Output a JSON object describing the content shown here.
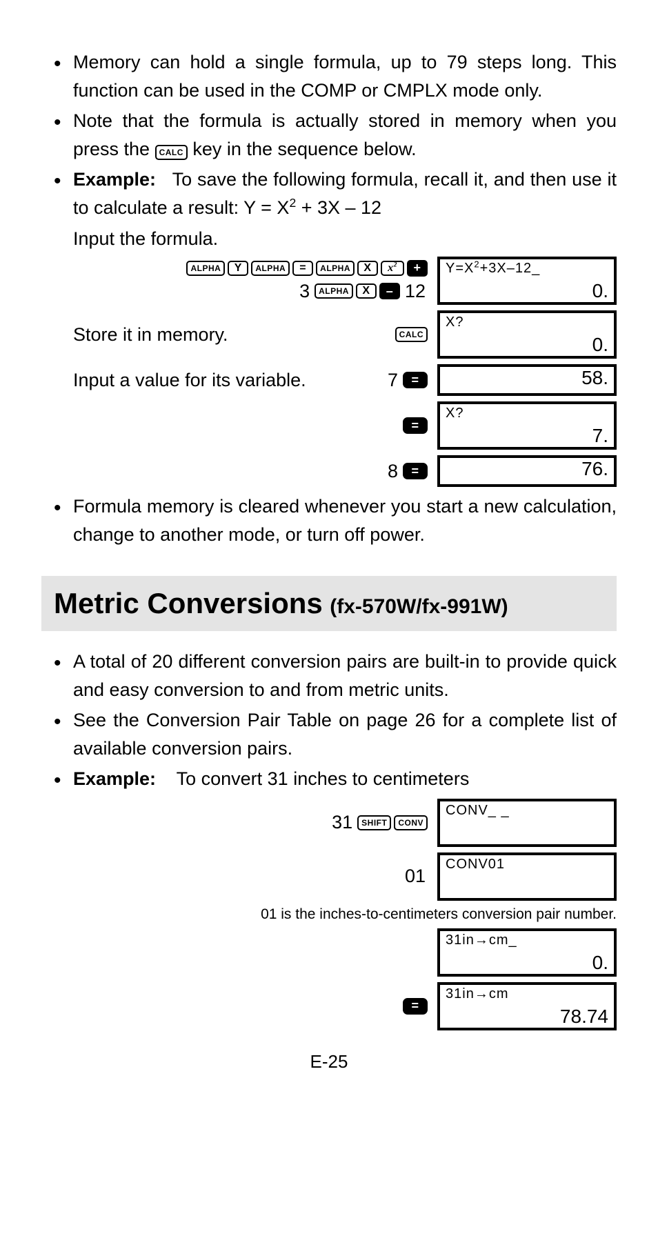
{
  "bullets_top": [
    "Memory can hold a single formula, up to 79 steps long. This function can be used in the COMP or CMPLX mode only.",
    "Note that the formula is actually stored in memory when you press the [CALC] key in the sequence below."
  ],
  "example1": {
    "label": "Example:",
    "text": "To save the following formula, recall it, and then use it to calculate a result: Y = X² + 3X – 12",
    "instr": "Input the formula."
  },
  "keys": {
    "alpha": "ALPHA",
    "Y": "Y",
    "eq": "=",
    "X": "X",
    "xsq": "x²",
    "plus": "+",
    "minus": "–",
    "calc": "CALC",
    "shift": "SHIFT",
    "conv": "CONV",
    "equals": "=",
    "three": "3",
    "twelve": "12",
    "seven": "7",
    "eight": "8",
    "thirtyone": "31",
    "zeroone": "01"
  },
  "displays": {
    "d1_top": "Y=X²+3X–12_",
    "d1_bot": "0.",
    "d2_top": "X?",
    "d2_bot": "0.",
    "d3_bot": "58.",
    "d4_top": "X?",
    "d4_bot": "7.",
    "d5_bot": "76.",
    "c1_top": "CONV_ _",
    "c2_top": "CONV01",
    "c3_top": "31in→cm_",
    "c3_bot": "0.",
    "c4_top": "31in→cm",
    "c4_bot": "78.74"
  },
  "steps": {
    "store": "Store it in memory.",
    "input_val": "Input a value for its variable."
  },
  "bullet_after": "Formula memory is cleared whenever you start a new calculation, change to another mode, or turn off power.",
  "heading": {
    "main": "Metric Conversions",
    "sub": "(fx-570W/fx-991W)"
  },
  "bullets_conv": [
    "A total of 20 different conversion pairs are built-in to provide quick and easy conversion to and from metric units.",
    "See the Conversion Pair Table on page 26 for a complete list of available conversion pairs."
  ],
  "example2": {
    "label": "Example:",
    "text": "To convert 31 inches to centimeters"
  },
  "note": "01 is the inches-to-centimeters conversion pair number.",
  "page_num": "E-25"
}
